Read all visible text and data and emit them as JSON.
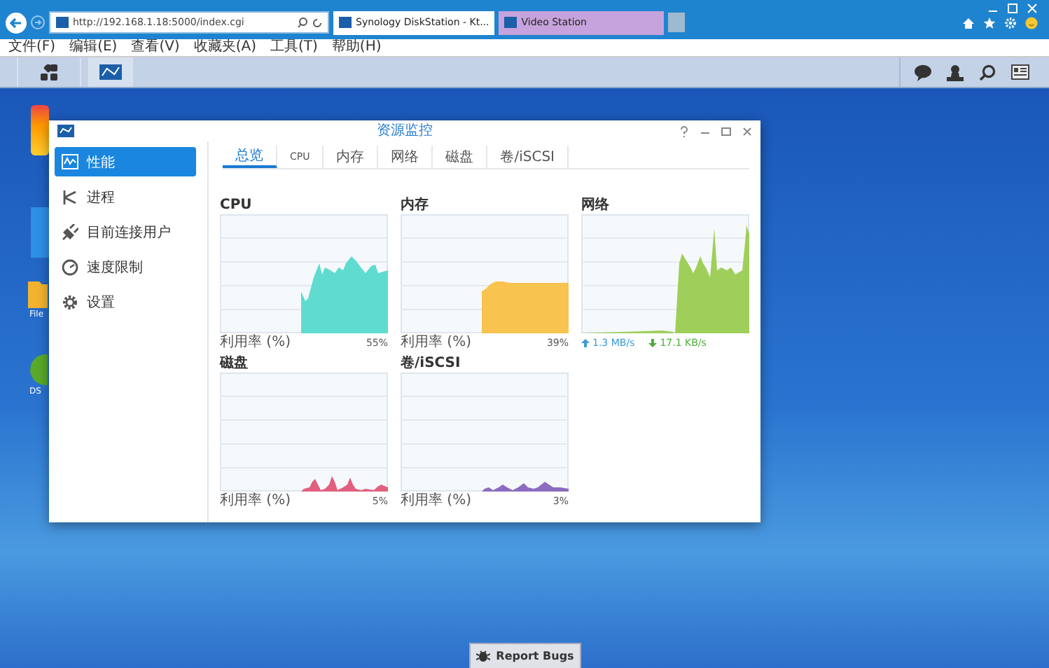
{
  "browser": {
    "address": "http://192.168.1.18:5000/index.cgi",
    "tabs": [
      {
        "label": "Synology DiskStation - Kt...",
        "selected": true
      },
      {
        "label": "Video Station",
        "selected": false
      }
    ],
    "menu": [
      "文件(F)",
      "编辑(E)",
      "查看(V)",
      "收藏夹(A)",
      "工具(T)",
      "帮助(H)"
    ]
  },
  "taskbar": {
    "apps": [
      {
        "kind": "grid",
        "selected": false
      },
      {
        "kind": "monitor",
        "selected": true
      }
    ]
  },
  "desktop_icons": [
    {
      "label": "File",
      "kind": "folder"
    },
    {
      "label": "DS",
      "kind": "circle"
    }
  ],
  "window": {
    "title": "资源监控",
    "sidebar": [
      {
        "label": "性能",
        "kind": "wave",
        "selected": true
      },
      {
        "label": "进程",
        "kind": "process",
        "selected": false
      },
      {
        "label": "目前连接用户",
        "kind": "plug",
        "selected": false
      },
      {
        "label": "速度限制",
        "kind": "gauge",
        "selected": false
      },
      {
        "label": "设置",
        "kind": "gear",
        "selected": false
      }
    ],
    "tabs": [
      {
        "label": "总览",
        "selected": true
      },
      {
        "label": "CPU",
        "selected": false
      },
      {
        "label": "内存",
        "selected": false
      },
      {
        "label": "网络",
        "selected": false
      },
      {
        "label": "磁盘",
        "selected": false
      },
      {
        "label": "卷/iSCSI",
        "selected": false
      }
    ],
    "charts": [
      {
        "title": "CPU",
        "kind": "cpu",
        "color": "#5fdccf",
        "footer": "利用率 (%)",
        "value": "55%"
      },
      {
        "title": "内存",
        "kind": "memory",
        "color": "#f9c34f",
        "footer": "利用率 (%)",
        "value": "39%"
      },
      {
        "title": "网络",
        "kind": "network",
        "color": "#9fcf5a",
        "readings": [
          {
            "text": "1.3 MB/s",
            "color": "#3a9ad9"
          },
          {
            "text": "17.1 KB/s",
            "color": "#4caf3a"
          }
        ]
      },
      {
        "title": "磁盘",
        "kind": "disk",
        "color": "#e0607e",
        "footer": "利用率 (%)",
        "value": "5%"
      },
      {
        "title": "卷/iSCSI",
        "kind": "volume",
        "color": "#8c6cc0",
        "footer": "利用率 (%)",
        "value": "3%"
      }
    ]
  },
  "report_button": "Report Bugs"
}
